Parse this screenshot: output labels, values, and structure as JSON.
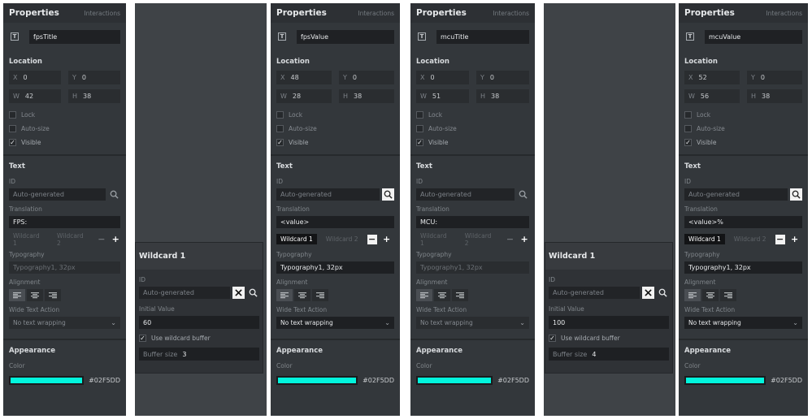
{
  "header": {
    "title": "Properties",
    "tab_interactions": "Interactions"
  },
  "sections": {
    "location": "Location",
    "text": "Text",
    "appearance": "Appearance"
  },
  "labels": {
    "x": "X",
    "y": "Y",
    "w": "W",
    "h": "H",
    "lock": "Lock",
    "auto_size": "Auto-size",
    "visible": "Visible",
    "id": "ID",
    "translation": "Translation",
    "typography": "Typography",
    "alignment": "Alignment",
    "wide_text_action": "Wide Text Action",
    "color": "Color"
  },
  "placeholders": {
    "auto_generated": "Auto-generated"
  },
  "wildcards": {
    "wc1": "Wildcard 1",
    "wc2": "Wildcard 2"
  },
  "panels": [
    {
      "name": "fpsTitle",
      "x": "0",
      "y": "0",
      "w": "42",
      "h": "38",
      "translation": "FPS:",
      "typography": "Typography1, 32px",
      "wide_text": "No text wrapping",
      "color_hex": "#02F5DD"
    },
    {
      "name": "fpsValue",
      "x": "48",
      "y": "0",
      "w": "28",
      "h": "38",
      "translation": "<value>",
      "typography": "Typography1, 32px",
      "wide_text": "No text wrapping",
      "color_hex": "#02F5DD"
    },
    {
      "name": "mcuTitle",
      "x": "0",
      "y": "0",
      "w": "51",
      "h": "38",
      "translation": "MCU:",
      "typography": "Typography1, 32px",
      "wide_text": "No text wrapping",
      "color_hex": "#02F5DD"
    },
    {
      "name": "mcuValue",
      "x": "52",
      "y": "0",
      "w": "56",
      "h": "38",
      "translation": "<value>%",
      "typography": "Typography1, 32px",
      "wide_text": "No text wrapping",
      "color_hex": "#02F5DD"
    }
  ],
  "popovers": [
    {
      "title": "Wildcard 1",
      "id_label": "ID",
      "id_placeholder": "Auto-generated",
      "initial_label": "Initial Value",
      "initial_value": "60",
      "use_buffer": "Use wildcard buffer",
      "buffer_label": "Buffer size",
      "buffer_value": "3"
    },
    {
      "title": "Wildcard 1",
      "id_label": "ID",
      "id_placeholder": "Auto-generated",
      "initial_label": "Initial Value",
      "initial_value": "100",
      "use_buffer": "Use wildcard buffer",
      "buffer_label": "Buffer size",
      "buffer_value": "4"
    }
  ],
  "colors": {
    "panel_bg": "#33373b",
    "accent": "#02F5DD"
  }
}
